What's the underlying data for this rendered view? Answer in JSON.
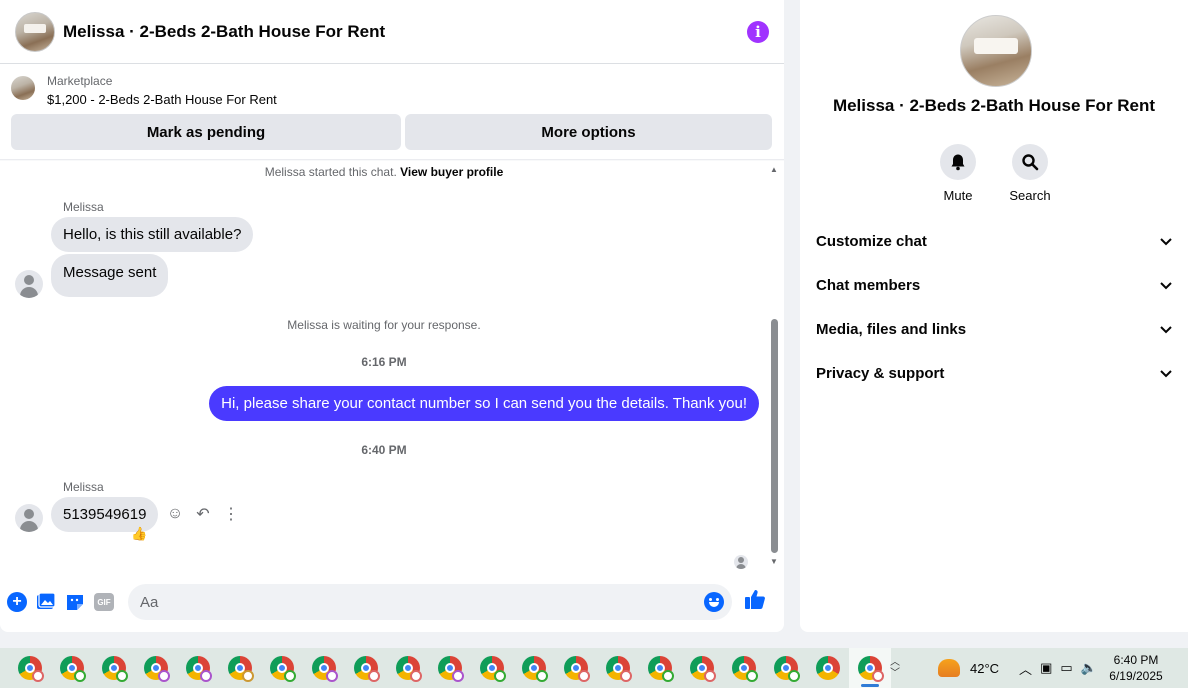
{
  "chat": {
    "title": "Melissa · 2-Beds 2-Bath House For Rent",
    "marketplace_label": "Marketplace",
    "listing": "$1,200 - 2-Beds 2-Bath House For Rent",
    "btn_pending": "Mark as pending",
    "btn_more": "More options",
    "started_prefix": "Melissa started this chat.",
    "started_link": "View buyer profile",
    "sender1": "Melissa",
    "msg1": "Hello, is this still available?",
    "msg2": "Message sent",
    "waiting": "Melissa is waiting for your response.",
    "time1": "6:16 PM",
    "msg_out": "Hi, please share your contact number so I can send you the details. Thank you!",
    "time2": "6:40 PM",
    "sender2": "Melissa",
    "msg3": "5139549619",
    "reaction": "👍",
    "input_placeholder": "Aa",
    "gif_label": "GIF"
  },
  "info": {
    "title": "Melissa · 2-Beds 2-Bath House For Rent",
    "mute": "Mute",
    "search": "Search",
    "sections": [
      "Customize chat",
      "Chat members",
      "Media, files and links",
      "Privacy & support"
    ]
  },
  "taskbar": {
    "temp": "42°C",
    "time": "6:40 PM",
    "date": "6/19/2025"
  },
  "colors": {
    "accent": "#0866ff",
    "outgoing_bubble": "#4a3aff",
    "info_icon": "#a033ff"
  }
}
